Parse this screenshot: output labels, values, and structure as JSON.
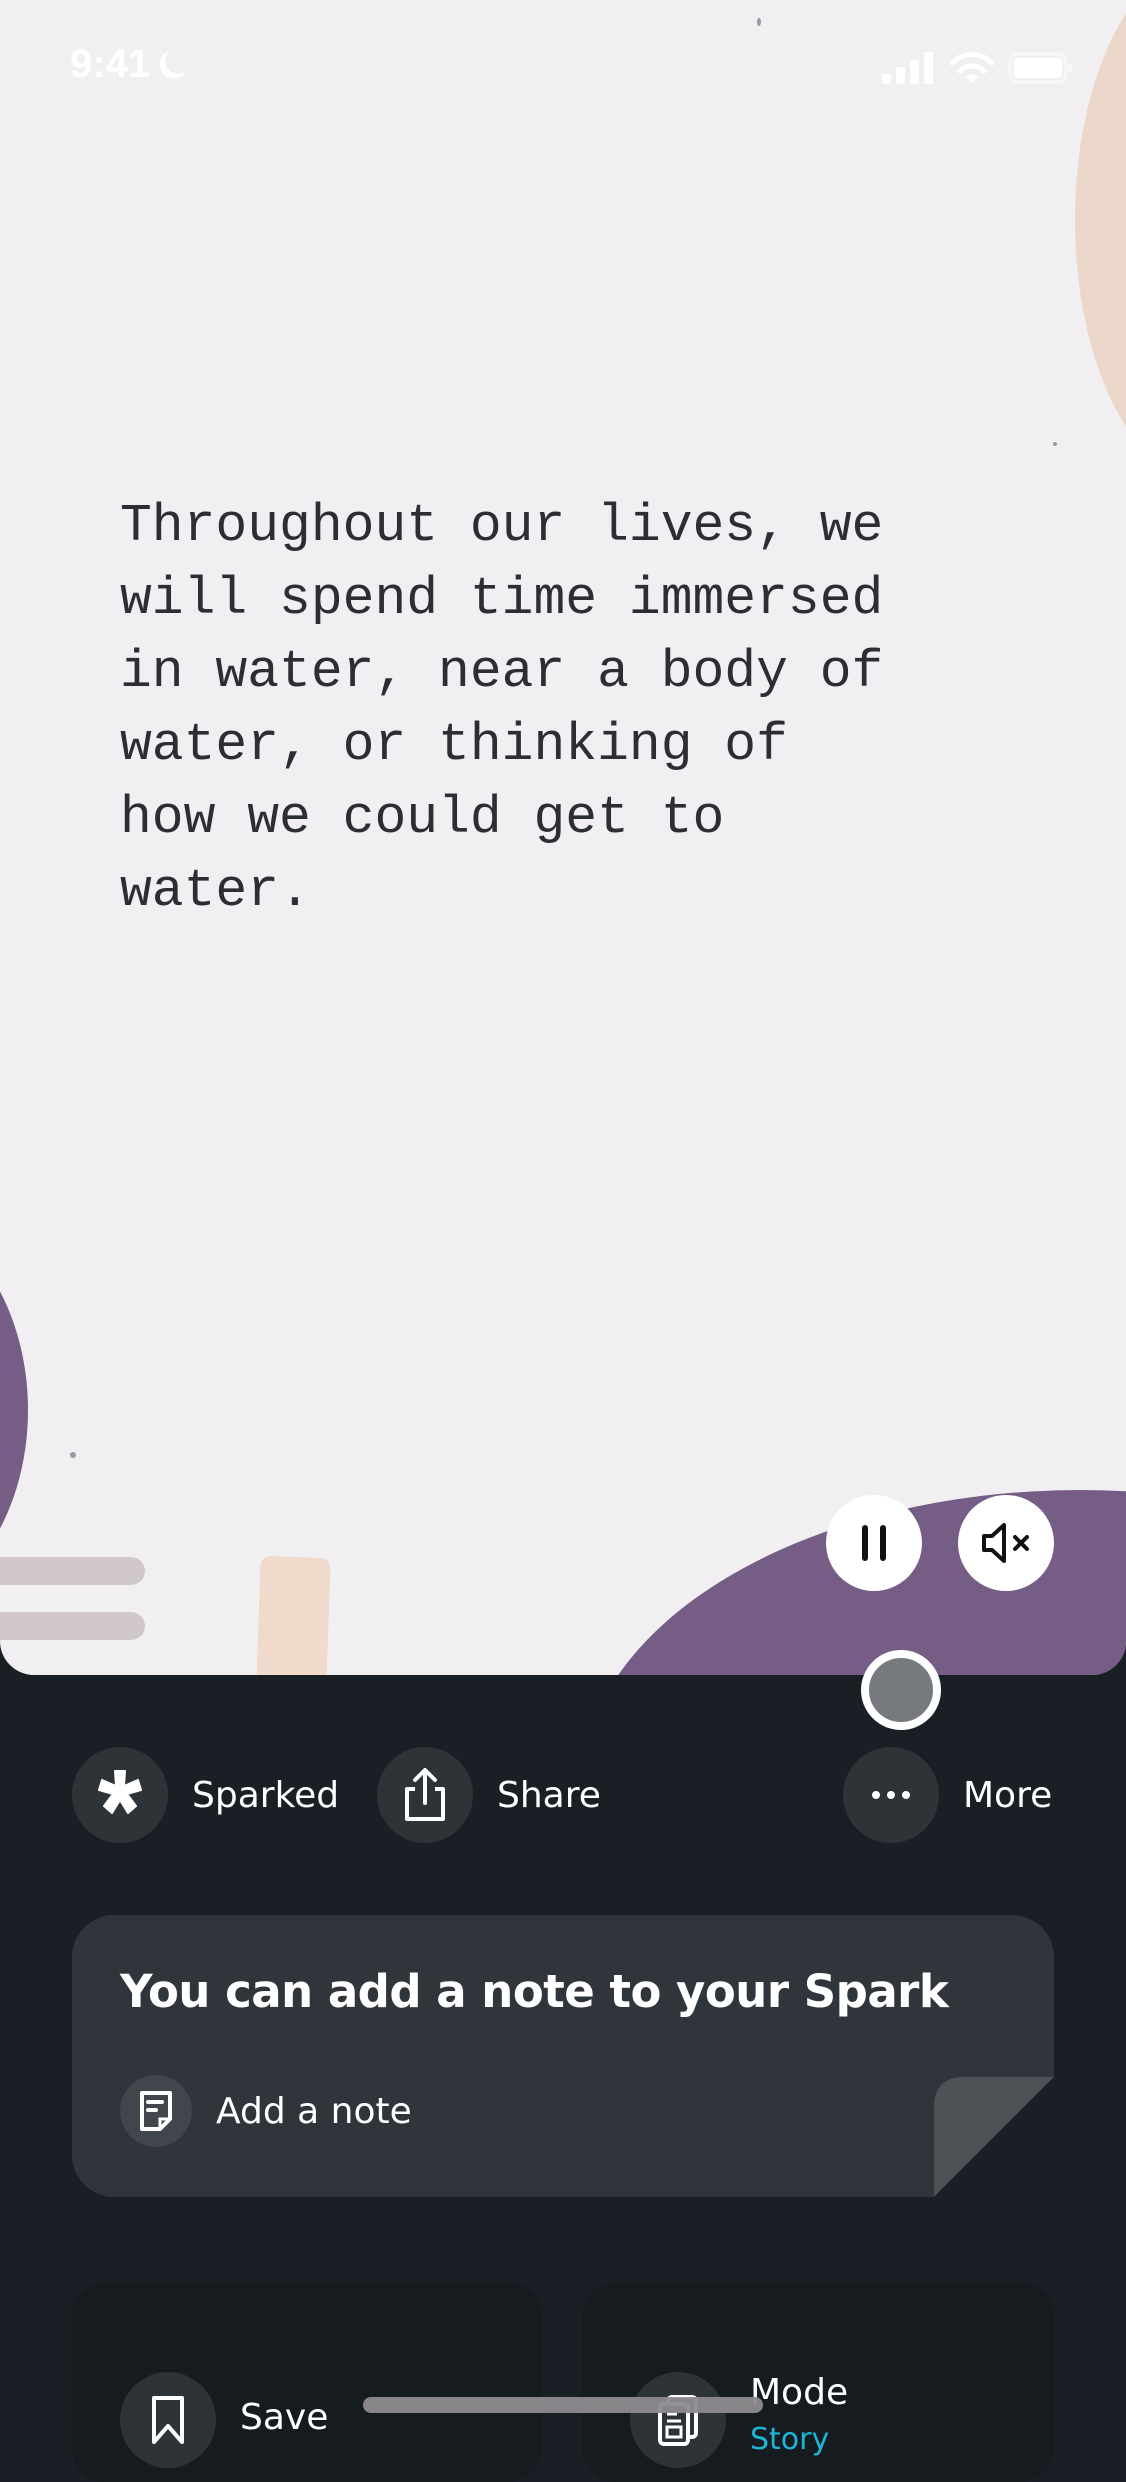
{
  "status_bar": {
    "time": "9:41",
    "focus_icon": "moon-icon",
    "signal_icon": "cellular-signal-icon",
    "wifi_icon": "wifi-icon",
    "battery_icon": "battery-icon"
  },
  "story": {
    "text": "Throughout our lives, we\nwill spend time immersed\nin water, near a body of\nwater, or thinking of\nhow we could get to\nwater.",
    "colors": {
      "background": "#f2eff3",
      "purple": "#765d86",
      "peach": "#ecd8cb",
      "text": "#2b2f33"
    }
  },
  "playback": {
    "pause_icon": "pause-icon",
    "mute_icon": "speaker-muted-icon",
    "progress": 0.8
  },
  "actions": [
    {
      "label": "Sparked",
      "icon": "spark-icon"
    },
    {
      "label": "Share",
      "icon": "share-icon"
    },
    {
      "label": "More",
      "icon": "ellipsis-icon"
    }
  ],
  "note_card": {
    "title": "You can add a note to your Spark",
    "add_label": "Add a note",
    "icon": "note-icon"
  },
  "tiles": {
    "save": {
      "label": "Save",
      "icon": "bookmark-icon"
    },
    "mode": {
      "label": "Mode",
      "value": "Story",
      "icon": "story-mode-icon",
      "value_color": "#1db4d6"
    }
  },
  "theme": {
    "dark_background": "#1a1f26",
    "card": "#2f353b",
    "icon_bg": "#2e3338"
  }
}
